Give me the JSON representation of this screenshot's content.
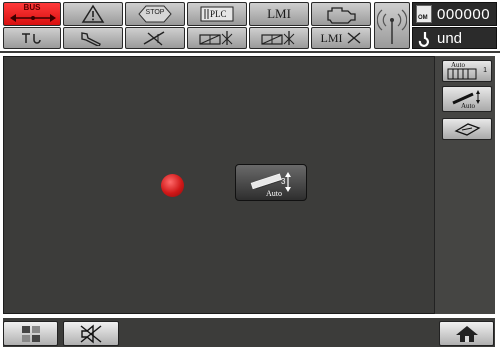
{
  "header": {
    "bus_label": "BUS",
    "stop_label": "STOP",
    "plc_label": "PLC",
    "lmi_label": "LMI",
    "lmi_x_label": "LMI",
    "om_label": "OM",
    "counter_value": "000000",
    "hook_status": "und",
    "colors": {
      "bus_red": "#e81e1e",
      "button_grey": "#b8b8b8"
    }
  },
  "main": {
    "status_dot_color": "#d01818",
    "auto_button_label": "Auto"
  },
  "side": {
    "btn1_label": "Auto",
    "btn1_sublabel": "1",
    "btn2_label": "Auto"
  },
  "footer": {
    "icons": [
      "grid-icon",
      "mute-icon",
      "home-icon"
    ]
  }
}
